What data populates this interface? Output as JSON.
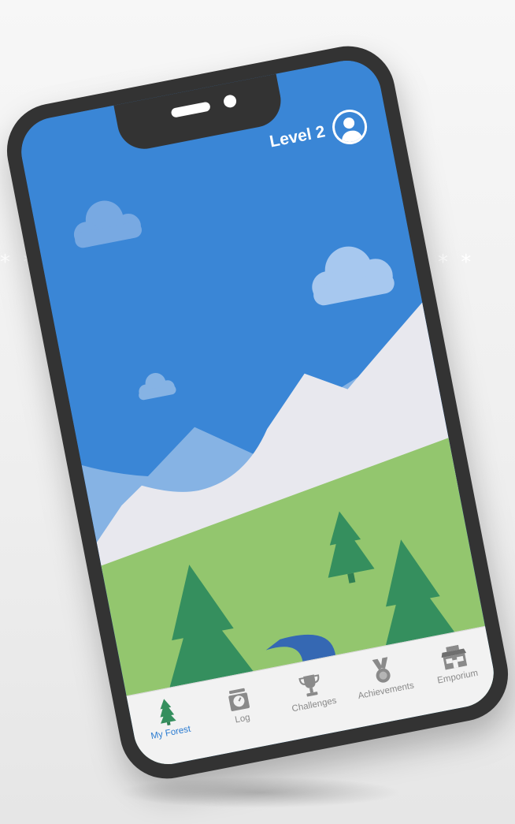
{
  "decor": {
    "stars_left": "* *",
    "stars_right": "* *"
  },
  "header": {
    "level_label": "Level 2"
  },
  "tabs": [
    {
      "label": "My Forest",
      "icon": "pine-tree-icon",
      "active": true
    },
    {
      "label": "Log",
      "icon": "scale-icon",
      "active": false
    },
    {
      "label": "Challenges",
      "icon": "trophy-icon",
      "active": false
    },
    {
      "label": "Achievements",
      "icon": "medal-icon",
      "active": false
    },
    {
      "label": "Emporium",
      "icon": "store-icon",
      "active": false
    }
  ],
  "colors": {
    "sky": "#3a86d6",
    "mountain_back": "#86b3e4",
    "mountain_front": "#e8e8ee",
    "grass": "#93c66e",
    "tree": "#358f5e",
    "river": "#3568b3",
    "active_tab": "#2a7bd1"
  }
}
